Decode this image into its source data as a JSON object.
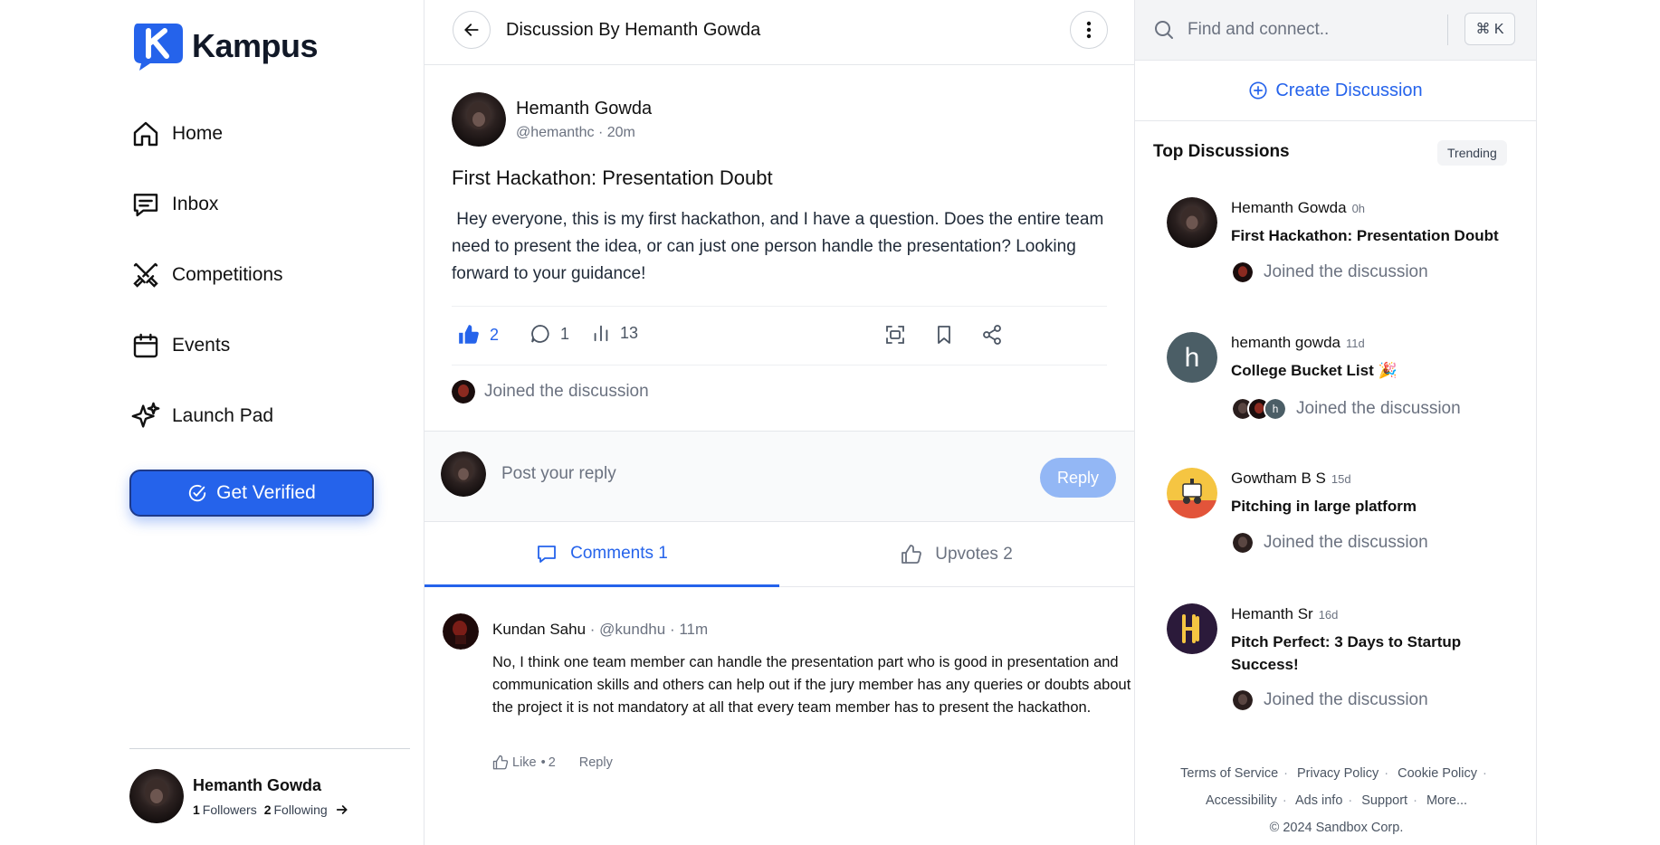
{
  "brand": {
    "name": "Kampus",
    "color": "#2563eb"
  },
  "nav": [
    {
      "label": "Home",
      "icon": "home-icon"
    },
    {
      "label": "Inbox",
      "icon": "inbox-icon"
    },
    {
      "label": "Competitions",
      "icon": "swords-icon"
    },
    {
      "label": "Events",
      "icon": "calendar-icon"
    },
    {
      "label": "Launch Pad",
      "icon": "sparkles-icon"
    }
  ],
  "verify_button": {
    "label": "Get Verified",
    "icon": "check-circle-icon"
  },
  "profile": {
    "name": "Hemanth Gowda",
    "followers_count": "1",
    "followers_label": "Followers",
    "following_count": "2",
    "following_label": "Following"
  },
  "header": {
    "title": "Discussion By Hemanth Gowda"
  },
  "post": {
    "author": "Hemanth Gowda",
    "handle": "@hemanthc",
    "time": "20m",
    "title": "First Hackathon: Presentation Doubt",
    "body": " Hey everyone, this is my first hackathon, and I have a question. Does the entire team need to present the idea, or can just one person handle the presentation? Looking forward to your guidance!",
    "likes": "2",
    "comments": "1",
    "views": "13",
    "joined_text": "Joined the discussion"
  },
  "reply": {
    "placeholder": "Post your reply",
    "button": "Reply"
  },
  "tabs": {
    "comments": "Comments 1",
    "upvotes": "Upvotes 2"
  },
  "comment": {
    "author": "Kundan Sahu",
    "handle": "@kundhu",
    "time": "11m",
    "body": "No, I think one team member can handle the presentation part who is good in presentation and communication skills and others can help out if the jury member has any queries or doubts about the project it is not mandatory at all that every team member has to present the hackathon.",
    "like_label": "Like",
    "like_count": "2",
    "reply_label": "Reply"
  },
  "search": {
    "placeholder": "Find and connect..",
    "shortcut": "⌘ K"
  },
  "create_discussion": "Create Discussion",
  "top_discussions": {
    "heading": "Top Discussions",
    "badge": "Trending",
    "items": [
      {
        "name": "Hemanth Gowda",
        "ago": "0h",
        "title": "First Hackathon: Presentation Doubt",
        "joined": "Joined the discussion"
      },
      {
        "name": "hemanth gowda",
        "ago": "11d",
        "title": "College Bucket List 🎉",
        "joined": "Joined the discussion",
        "avatar_letter": "h"
      },
      {
        "name": "Gowtham B S",
        "ago": "15d",
        "title": "Pitching in large platform",
        "joined": "Joined the discussion"
      },
      {
        "name": "Hemanth Sr",
        "ago": "16d",
        "title": "Pitch Perfect: 3 Days to Startup Success!",
        "joined": "Joined the discussion"
      }
    ]
  },
  "footer": {
    "terms": "Terms of Service",
    "privacy": "Privacy Policy",
    "cookie": "Cookie Policy",
    "accessibility": "Accessibility",
    "ads": "Ads info",
    "support": "Support",
    "more": "More...",
    "copyright": "© 2024 Sandbox Corp."
  }
}
